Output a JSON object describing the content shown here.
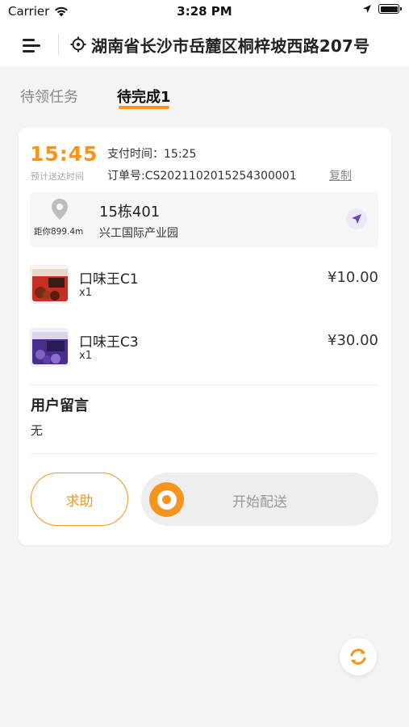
{
  "status_bar": {
    "carrier": "Carrier",
    "time": "3:28 PM",
    "icons": [
      "wifi-icon",
      "location-arrow-icon",
      "battery-icon"
    ]
  },
  "header": {
    "menu_icon": "menu-icon",
    "location_icon": "locate-icon",
    "address": "湖南省长沙市岳麓区桐梓坡西路207号"
  },
  "tabs": [
    {
      "label": "待领任务",
      "active": false
    },
    {
      "label": "待完成1",
      "active": true
    }
  ],
  "order": {
    "eta_time": "15:45",
    "eta_label": "预计送达时间",
    "pay_time": "支付时间：15:25",
    "order_no": "订单号:CS2021102015254300001",
    "copy_label": "复制",
    "distance": "距你899.4m",
    "building": "15栋401",
    "park": "兴工国际产业园",
    "items": [
      {
        "name": "口味王C1",
        "qty": "x1",
        "price": "¥10.00"
      },
      {
        "name": "口味王C3",
        "qty": "x1",
        "price": "¥30.00"
      }
    ],
    "message_title": "用户留言",
    "message_text": "无",
    "help_label": "求助",
    "start_label": "开始配送"
  },
  "colors": {
    "accent": "#f7941d",
    "nav_purple": "#6a3fd0",
    "background": "#f4f4f4"
  }
}
